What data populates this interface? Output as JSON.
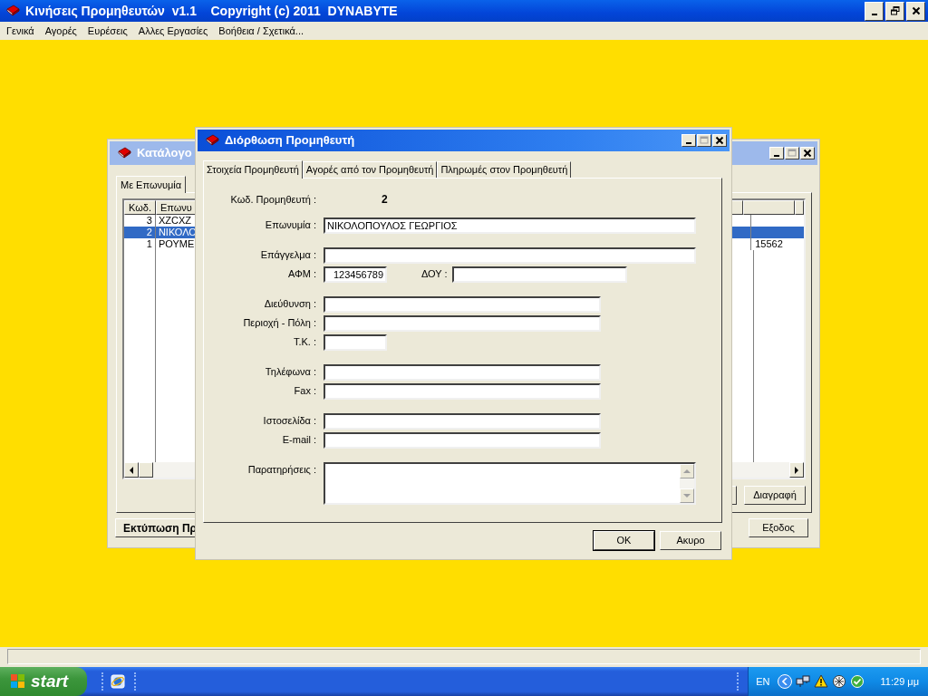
{
  "app": {
    "title": "Κινήσεις Προμηθευτών  v1.1    Copyright (c) 2011  DYNABYTE"
  },
  "menu": [
    {
      "label": "Γενικά"
    },
    {
      "label": "Αγορές"
    },
    {
      "label": "Ευρέσεις"
    },
    {
      "label": "Αλλες Εργασίες"
    },
    {
      "label": "Βοήθεια / Σχετικά..."
    }
  ],
  "list_window": {
    "title": "Κατάλογο",
    "tabs": [
      {
        "label": "Με Επωνυμία",
        "selected": true
      }
    ],
    "columns": [
      "Κωδ.",
      "Επωνυ",
      "",
      ""
    ],
    "rows": [
      {
        "code": "3",
        "name": "XZCXZ",
        "postcode": "",
        "selected": false
      },
      {
        "code": "2",
        "name": "ΝΙΚΟΛΟ",
        "postcode": "",
        "selected": true
      },
      {
        "code": "1",
        "name": "ΡΟΥΜΕ",
        "postcode": "15562",
        "selected": false
      }
    ],
    "delete_button": "Διαγραφή",
    "print_button": "Εκτύπωση Πρ",
    "exit_button": "Εξοδος"
  },
  "dialog": {
    "title": "Διόρθωση Προμηθευτή",
    "tabs": [
      {
        "label": "Στοιχεία Προμηθευτή",
        "selected": true
      },
      {
        "label": "Αγορές από τον Προμηθευτή",
        "selected": false
      },
      {
        "label": "Πληρωμές στον Προμηθευτή",
        "selected": false
      }
    ],
    "code_label": "Κωδ. Προμηθευτή :",
    "code_value": "2",
    "groups": [
      [
        [
          {
            "label": "Επωνυμία :",
            "value": "ΝΙΚΟΛΟΠΟΥΛΟΣ ΓΕΩΡΓΙΟΣ",
            "kind": "long"
          }
        ]
      ],
      [
        [
          {
            "label": "Επάγγελμα :",
            "kind": "long"
          }
        ],
        [
          {
            "label": "ΑΦΜ :",
            "value": "123456789",
            "kind": "tiny"
          },
          {
            "label": "ΔΟΥ :",
            "kind": "short"
          }
        ]
      ],
      [
        [
          {
            "label": "Διεύθυνση :",
            "kind": "medium"
          }
        ],
        [
          {
            "label": "Περιοχή - Πόλη :",
            "kind": "medium"
          }
        ],
        [
          {
            "label": "Τ.Κ. :",
            "kind": "tiny"
          }
        ]
      ],
      [
        [
          {
            "label": "Τηλέφωνα :",
            "kind": "medium"
          }
        ],
        [
          {
            "label": "Fax :",
            "kind": "medium"
          }
        ]
      ],
      [
        [
          {
            "label": "Ιστοσελίδα :",
            "kind": "medium"
          }
        ],
        [
          {
            "label": "E-mail :",
            "kind": "medium"
          }
        ]
      ],
      [
        [
          {
            "label": "Παρατηρήσεις :",
            "kind": "memo"
          }
        ]
      ]
    ],
    "buttons": [
      {
        "label": "OK",
        "default": true
      },
      {
        "label": "Ακυρο",
        "default": false
      }
    ]
  },
  "taskbar": {
    "start": "start",
    "language": "EN",
    "clock": "11:29 μμ"
  }
}
